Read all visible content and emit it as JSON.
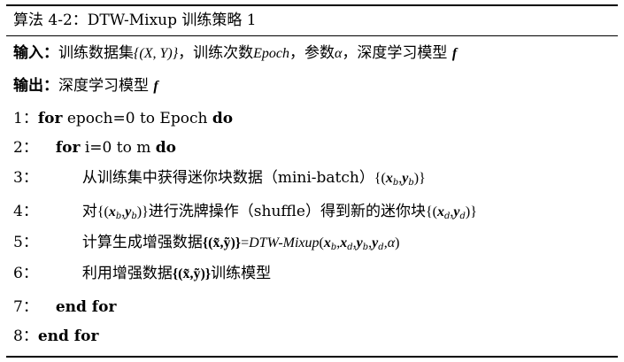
{
  "algorithm": {
    "title": "算法 4-2：DTW-Mixup 训练策略 1",
    "input": {
      "label": "输入：",
      "text1": "训练数据集",
      "dataset": "{(X, Y)}",
      "text2": "，训练次数",
      "epoch": "Epoch",
      "text3": "，参数",
      "alpha": "α",
      "text4": "，深度学习模型",
      "model": "f"
    },
    "output": {
      "label": "输出：",
      "text": "深度学习模型",
      "model": "f"
    },
    "lines": [
      {
        "num": "1：",
        "kw1": "for",
        "text": " epoch=0 to Epoch ",
        "kw2": "do"
      },
      {
        "num": "2：",
        "kw1": "for",
        "text": " i=0 to m ",
        "kw2": "do"
      },
      {
        "num": "3：",
        "text": "从训练集中获得迷你块数据（mini-batch）",
        "math_open": "{(",
        "x": "x",
        "xsub": "b",
        "comma": ",",
        "y": "y",
        "ysub": "b",
        "math_close": ")}"
      },
      {
        "num": "4：",
        "text1": "对",
        "math_open": "{(",
        "x": "x",
        "xsub": "b",
        "comma": ",",
        "y": "y",
        "ysub": "b",
        "math_close": ")}",
        "text2": "进行洗牌操作（shuffle）得到新的迷你块",
        "math2_open": "{(",
        "x2": "x",
        "x2sub": "d",
        "comma2": ",",
        "y2": "y",
        "y2sub": "d",
        "math2_close": ")}"
      },
      {
        "num": "5：",
        "text": "计算生成增强数据",
        "set": "{(x̃,ỹ)}",
        "eq": "=",
        "fn": "DTW-Mixup",
        "p_open": "(",
        "a1": "x",
        "a1sub": "b",
        "c1": ",",
        "a2": "x",
        "a2sub": "d",
        "c2": ",",
        "a3": "y",
        "a3sub": "b",
        "c3": ",",
        "a4": "y",
        "a4sub": "d",
        "c4": ",",
        "a5": "α",
        "p_close": ")"
      },
      {
        "num": "6：",
        "text1": "利用增强数据",
        "set": "{(x̃,ỹ)}",
        "text2": "训练模型"
      },
      {
        "num": "7：",
        "kw": "end for"
      },
      {
        "num": "8：",
        "kw": "end for"
      }
    ]
  }
}
